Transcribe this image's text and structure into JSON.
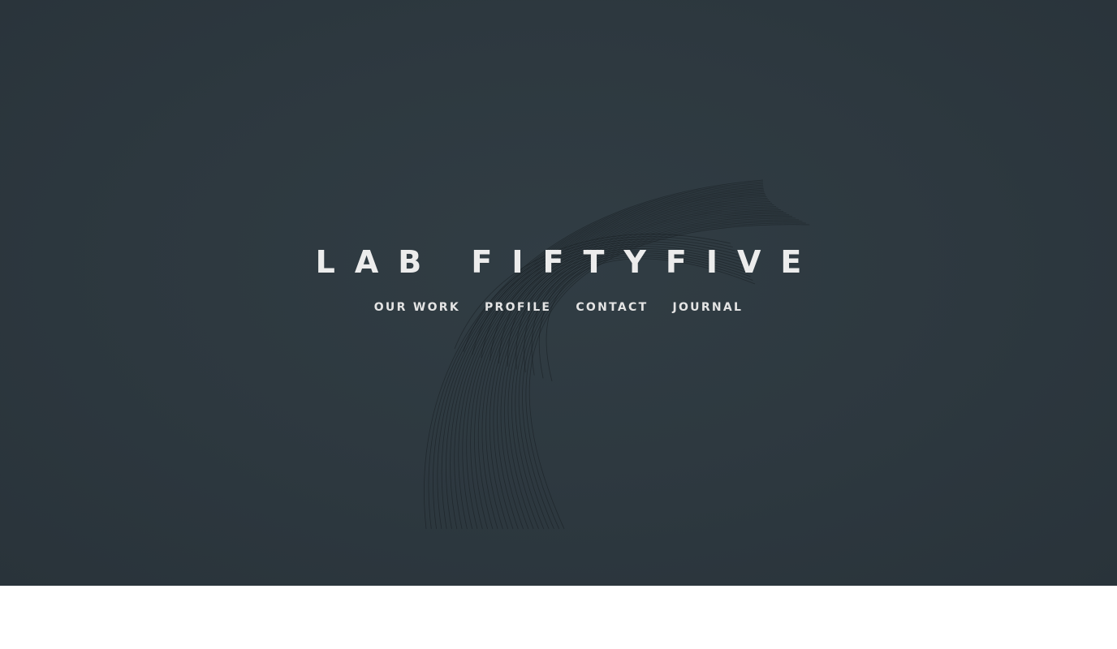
{
  "site": {
    "brand_name": "LAB FIFTYFIVE"
  },
  "nav": {
    "items": [
      {
        "label": "OUR WORK"
      },
      {
        "label": "PROFILE"
      },
      {
        "label": "CONTACT"
      },
      {
        "label": "JOURNAL"
      }
    ]
  },
  "colors": {
    "hero_background": "#2d383f",
    "text": "#ececec",
    "page_background": "#ffffff"
  }
}
